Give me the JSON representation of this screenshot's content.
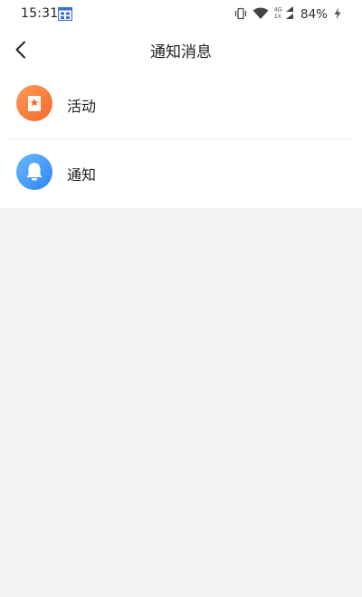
{
  "status_bar": {
    "time": "15:31",
    "battery_text": "84%",
    "network_label_top": "4G",
    "network_label_bottom": "1X",
    "icons": [
      "calendar-icon",
      "vibrate-icon",
      "wifi-icon",
      "signal-icon",
      "charging-icon"
    ]
  },
  "header": {
    "title": "通知消息",
    "back_icon": "chevron-left-icon"
  },
  "list": {
    "items": [
      {
        "label": "活动",
        "icon": "activity-icon",
        "color": "#f47a3a"
      },
      {
        "label": "通知",
        "icon": "bell-icon",
        "color": "#3a8ff5"
      }
    ]
  }
}
